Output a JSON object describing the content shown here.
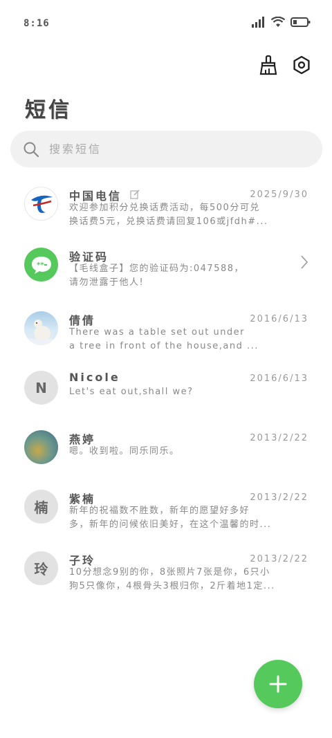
{
  "status": {
    "time": "8:16"
  },
  "title": "短信",
  "search": {
    "placeholder": "搜索短信"
  },
  "messages": [
    {
      "name": "中国电信",
      "date": "2025/9/30",
      "line1": "欢迎参加积分兑换话费活动，每500分可兑",
      "line2": "换话费5元，兑换话费请回复106或jfdh#..."
    },
    {
      "name": "验证码",
      "date": "",
      "line1": "【毛线盒子】您的验证码为:047588，",
      "line2": "请勿泄露于他人!"
    },
    {
      "name": "倩倩",
      "date": "2016/6/13",
      "line1": "There was a table set out under",
      "line2": "a tree in front of the house,and ..."
    },
    {
      "name": "Nicole",
      "date": "2016/6/13",
      "line1": "Let's eat out,shall we?",
      "line2": ""
    },
    {
      "name": "燕婷",
      "date": "2013/2/22",
      "line1": "嗯。收到啦。同乐同乐。",
      "line2": ""
    },
    {
      "name": "紫楠",
      "date": "2013/2/22",
      "line1": "新年的祝福数不胜数，新年的愿望好多好",
      "line2": "多，新年的问候依旧美好，在这个温馨的时..."
    },
    {
      "name": "子玲",
      "date": "2013/2/22",
      "line1": "10分想念9别的你，8张照片7张是你，6只小",
      "line2": "狗5只像你，4根骨头3根归你，2斤着地1定..."
    }
  ],
  "avatars": {
    "nicole": "N",
    "zinan": "楠",
    "ziling": "玲"
  },
  "colors": {
    "accent": "#55c95b",
    "telecom_blue": "#1565c0"
  }
}
